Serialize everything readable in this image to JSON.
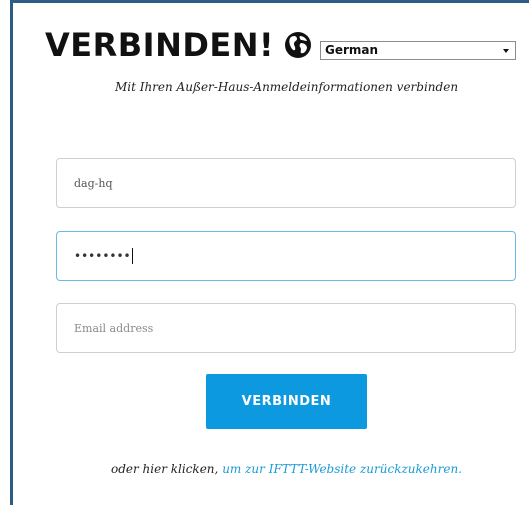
{
  "header": {
    "title": "VERBINDEN!",
    "globe_icon": "globe-icon",
    "language_selected": "German"
  },
  "subtitle": "Mit Ihren Außer-Haus-Anmeldeinformationen verbinden",
  "form": {
    "username_value": "dag-hq",
    "password_masked": "••••••••",
    "email_placeholder": "Email address",
    "submit_label": "VERBINDEN"
  },
  "footer": {
    "prefix": "oder hier klicken,",
    "link_text": "um zur IFTTT-Website zurückzukehren."
  },
  "colors": {
    "accent": "#0d99e0",
    "link": "#1a9bd7",
    "frame_border": "#2b5d86",
    "focus_border": "#66bde3"
  }
}
